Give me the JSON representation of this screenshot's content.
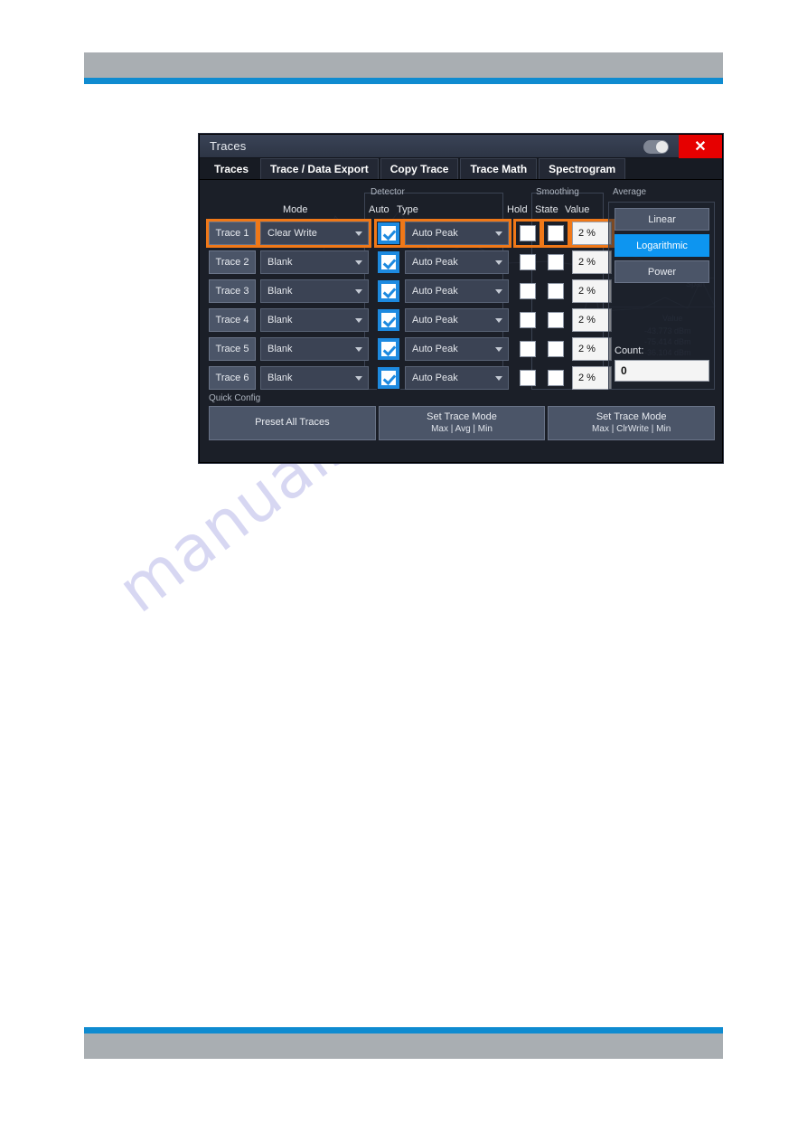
{
  "page": {
    "header_band_color": "#a9aeb2",
    "accent_color": "#0f8bd0",
    "watermark": "manualshive.com"
  },
  "dialog": {
    "title": "Traces",
    "help_toggle_name": "help-toggle",
    "close_label": "✕",
    "tabs": [
      {
        "label": "Traces",
        "active": true
      },
      {
        "label": "Trace / Data Export",
        "active": false
      },
      {
        "label": "Copy Trace",
        "active": false
      },
      {
        "label": "Trace Math",
        "active": false
      },
      {
        "label": "Spectrogram",
        "active": false
      }
    ],
    "groups": {
      "detector": "Detector",
      "smoothing": "Smoothing",
      "average": "Average",
      "quick_config": "Quick Config"
    },
    "column_headers": {
      "mode": "Mode",
      "auto": "Auto",
      "type": "Type",
      "hold": "Hold",
      "state": "State",
      "value": "Value"
    },
    "rows": [
      {
        "trace": "Trace 1",
        "mode": "Clear Write",
        "auto": true,
        "type": "Auto Peak",
        "hold": false,
        "state": false,
        "value": "2 %",
        "highlighted": true
      },
      {
        "trace": "Trace 2",
        "mode": "Blank",
        "auto": true,
        "type": "Auto Peak",
        "hold": false,
        "state": false,
        "value": "2 %",
        "highlighted": false
      },
      {
        "trace": "Trace 3",
        "mode": "Blank",
        "auto": true,
        "type": "Auto Peak",
        "hold": false,
        "state": false,
        "value": "2 %",
        "highlighted": false
      },
      {
        "trace": "Trace 4",
        "mode": "Blank",
        "auto": true,
        "type": "Auto Peak",
        "hold": false,
        "state": false,
        "value": "2 %",
        "highlighted": false
      },
      {
        "trace": "Trace 5",
        "mode": "Blank",
        "auto": true,
        "type": "Auto Peak",
        "hold": false,
        "state": false,
        "value": "2 %",
        "highlighted": false
      },
      {
        "trace": "Trace 6",
        "mode": "Blank",
        "auto": true,
        "type": "Auto Peak",
        "hold": false,
        "state": false,
        "value": "2 %",
        "highlighted": false
      }
    ],
    "average": {
      "options": [
        {
          "label": "Linear",
          "selected": false
        },
        {
          "label": "Logarithmic",
          "selected": true
        },
        {
          "label": "Power",
          "selected": false
        }
      ],
      "count_label": "Count:",
      "count_value": "0",
      "selected_color": "#0d95f0"
    },
    "quick_config": {
      "buttons": [
        {
          "label": "Preset All Traces",
          "sub": ""
        },
        {
          "label": "Set Trace Mode",
          "sub": "Max | Avg | Min"
        },
        {
          "label": "Set Trace Mode",
          "sub": "Max | ClrWrite | Min"
        }
      ]
    },
    "highlight_color": "#f07818"
  },
  "background_ghost": {
    "labels": [
      "Span",
      "Value",
      "-43.773 dBm",
      "-75.414 dBm",
      "-36.104 dBm"
    ]
  }
}
